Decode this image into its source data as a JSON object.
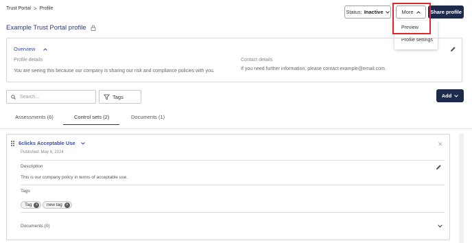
{
  "breadcrumb": {
    "items": [
      "Trust Portal",
      "Profile"
    ],
    "separator": ">"
  },
  "page_title": "Example Trust Portal profile",
  "header": {
    "status_label": "Status:",
    "status_value": "Inactive",
    "more_label": "More",
    "share_label": "Share profile"
  },
  "more_menu": {
    "items": [
      "Preview",
      "Profile settings"
    ]
  },
  "overview": {
    "title": "Overview",
    "left_label": "Profile details",
    "left_text": "You are seeing this because our company is sharing our risk and compliance policies with you.",
    "right_label": "Contact details",
    "right_text": "If you need further information, please contact example@email.com."
  },
  "toolbar": {
    "search_placeholder": "Search...",
    "tags_label": "Tags",
    "add_label": "Add"
  },
  "tabs": [
    {
      "label": "Assessments (6)",
      "active": false
    },
    {
      "label": "Control sets (2)",
      "active": true
    },
    {
      "label": "Documents (1)",
      "active": false
    }
  ],
  "control_set": {
    "title": "6clicks Acceptable Use",
    "published": "Published: May 6, 2024",
    "description_label": "Description",
    "description_text": "This is our company policy in terms of acceptable use.",
    "tags_label": "Tags",
    "tags": [
      "Tag",
      "new tag"
    ],
    "documents_label": "Documents (0)"
  },
  "colors": {
    "primary": "#1d2a4b",
    "accent": "#3b4aa0",
    "highlight": "#e0242b"
  },
  "icons": [
    "chevron-down-icon",
    "chevron-up-icon",
    "lock-icon",
    "pencil-icon",
    "search-icon",
    "filter-icon",
    "grip-icon",
    "close-icon"
  ]
}
